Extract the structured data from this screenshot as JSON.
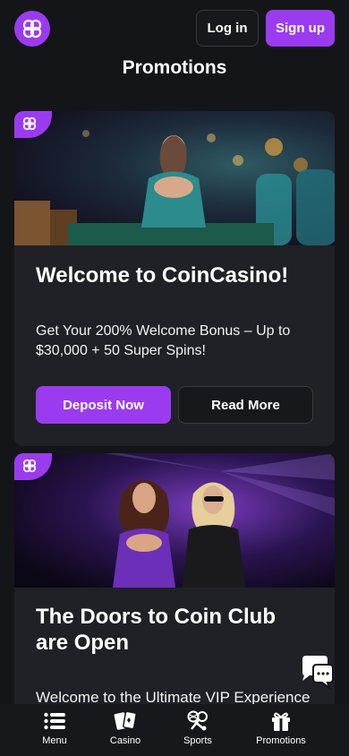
{
  "header": {
    "login_label": "Log in",
    "signup_label": "Sign up"
  },
  "page": {
    "title": "Promotions"
  },
  "promotions": [
    {
      "title": "Welcome to CoinCasino!",
      "description": "Get Your 200% Welcome Bonus – Up to $30,000 + 50 Super Spins!",
      "primary_label": "Deposit Now",
      "secondary_label": "Read More"
    },
    {
      "title": "The Doors to Coin Club are Open",
      "description": "Welcome to the Ultimate VIP Experience"
    }
  ],
  "nav": [
    {
      "label": "Menu",
      "icon": "menu-icon"
    },
    {
      "label": "Casino",
      "icon": "cards-icon"
    },
    {
      "label": "Sports",
      "icon": "sports-icon"
    },
    {
      "label": "Promotions",
      "icon": "gift-icon"
    }
  ],
  "colors": {
    "accent": "#9b3bf0",
    "background": "#141519",
    "card": "#1f2126"
  }
}
